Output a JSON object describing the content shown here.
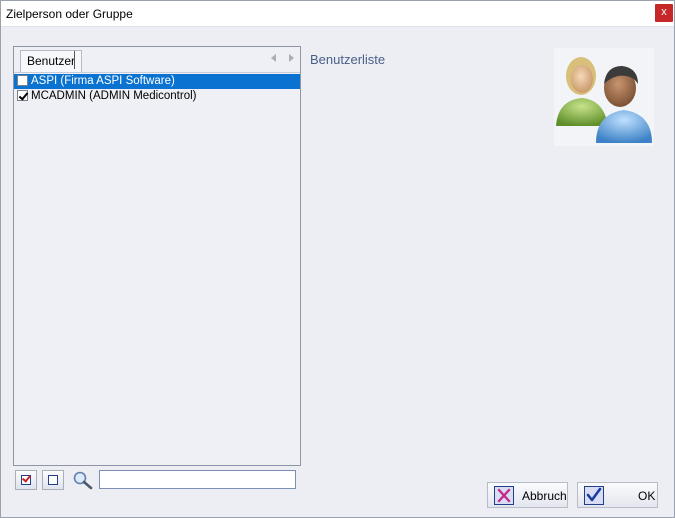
{
  "window": {
    "title": "Zielperson oder Gruppe",
    "close_glyph": "x"
  },
  "tabs": [
    {
      "label": "Benutzer"
    }
  ],
  "list": {
    "heading": "Benutzerliste",
    "items": [
      {
        "label": "ASPI (Firma ASPI Software)",
        "checked": false,
        "selected": true
      },
      {
        "label": "MCADMIN (ADMIN Medicontrol)",
        "checked": true,
        "selected": false
      }
    ]
  },
  "toolbar": {
    "check_all_icon": "check-all-icon",
    "uncheck_all_icon": "uncheck-all-icon",
    "search_icon": "magnifier-icon",
    "search_value": ""
  },
  "buttons": {
    "cancel_label": "Abbruch",
    "ok_label": "OK"
  },
  "colors": {
    "selection": "#0a73d1",
    "close_button": "#c6282a",
    "heading": "#4a5f86"
  }
}
